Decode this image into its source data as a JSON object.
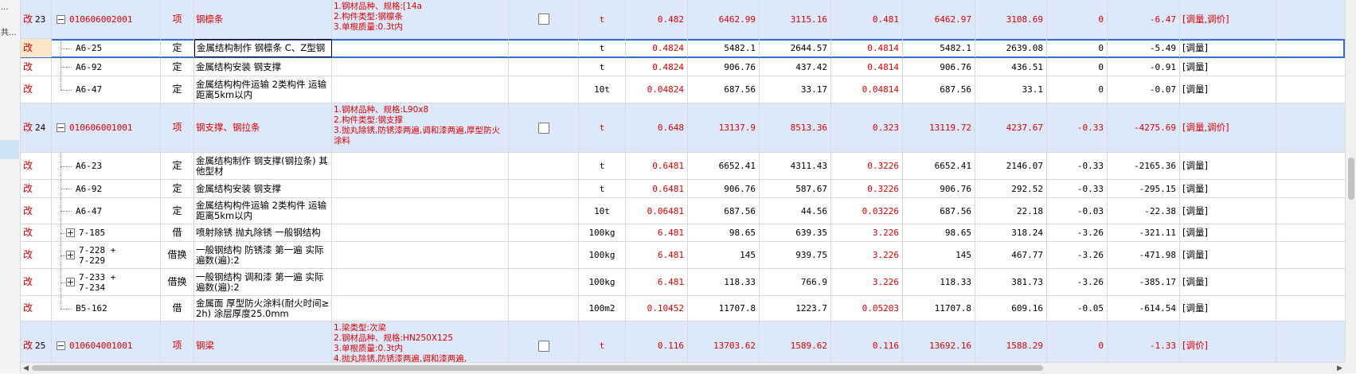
{
  "left_pane": {
    "t1": "...",
    "t2": "共..."
  },
  "rows": [
    {
      "type": "item",
      "mark": "改",
      "no": "23",
      "code": "010606002001",
      "kind": "项",
      "name": "钢檩条",
      "features": "1.钢材品种、规格:[14a\n2.构件类型:钢檩条\n3.单根质量:0.3t内",
      "unit": "t",
      "n1": "0.482",
      "n2": "6462.99",
      "n3": "3115.16",
      "n4": "0.481",
      "n5": "6462.97",
      "n6": "3108.69",
      "n7": "0",
      "n8": "-6.47",
      "adj": "[调量,调价]"
    },
    {
      "type": "sub",
      "mark": "改",
      "code": "A6-25",
      "kind": "定",
      "name": "金属结构制作 钢檩条 C、Z型钢",
      "unit": "t",
      "n1": "0.4824",
      "n2": "5482.1",
      "n3": "2644.57",
      "n4": "0.4814",
      "n5": "5482.1",
      "n6": "2639.08",
      "n7": "0",
      "n8": "-5.49",
      "adj": "[调量]"
    },
    {
      "type": "sub",
      "mark": "改",
      "code": "A6-92",
      "kind": "定",
      "name": "金属结构安装 钢支撑",
      "unit": "t",
      "n1": "0.4824",
      "n2": "906.76",
      "n3": "437.42",
      "n4": "0.4814",
      "n5": "906.76",
      "n6": "436.51",
      "n7": "0",
      "n8": "-0.91",
      "adj": "[调量]"
    },
    {
      "type": "sub",
      "mark": "改",
      "code": "A6-47",
      "kind": "定",
      "name": "金属结构构件运输 2类构件 运输距离5km以内",
      "unit": "10t",
      "n1": "0.04824",
      "n2": "687.56",
      "n3": "33.17",
      "n4": "0.04814",
      "n5": "687.56",
      "n6": "33.1",
      "n7": "0",
      "n8": "-0.07",
      "adj": "[调量]"
    },
    {
      "type": "item",
      "mark": "改",
      "no": "24",
      "code": "010606001001",
      "kind": "项",
      "name": "钢支撑、钢拉条",
      "features": "1.钢材品种、规格:L90x8\n2.构件类型:钢支撑\n3.抛丸除锈,防锈漆两遍,调和漆两遍,厚型防火涂料",
      "unit": "t",
      "n1": "0.648",
      "n2": "13137.9",
      "n3": "8513.36",
      "n4": "0.323",
      "n5": "13119.72",
      "n6": "4237.67",
      "n7": "-0.33",
      "n8": "-4275.69",
      "adj": "[调量,调价]"
    },
    {
      "type": "sub",
      "mark": "改",
      "code": "A6-23",
      "kind": "定",
      "name": "金属结构制作 钢支撑(钢拉条) 其他型材",
      "unit": "t",
      "n1": "0.6481",
      "n2": "6652.41",
      "n3": "4311.43",
      "n4": "0.3226",
      "n5": "6652.41",
      "n6": "2146.07",
      "n7": "-0.33",
      "n8": "-2165.36",
      "adj": "[调量]"
    },
    {
      "type": "sub",
      "mark": "改",
      "code": "A6-92",
      "kind": "定",
      "name": "金属结构安装 钢支撑",
      "unit": "t",
      "n1": "0.6481",
      "n2": "906.76",
      "n3": "587.67",
      "n4": "0.3226",
      "n5": "906.76",
      "n6": "292.52",
      "n7": "-0.33",
      "n8": "-295.15",
      "adj": "[调量]"
    },
    {
      "type": "sub",
      "mark": "改",
      "code": "A6-47",
      "kind": "定",
      "name": "金属结构构件运输 2类构件 运输距离5km以内",
      "unit": "10t",
      "n1": "0.06481",
      "n2": "687.56",
      "n3": "44.56",
      "n4": "0.03226",
      "n5": "687.56",
      "n6": "22.18",
      "n7": "-0.03",
      "n8": "-22.38",
      "adj": "[调量]"
    },
    {
      "type": "sub",
      "mark": "改",
      "code": "7-185",
      "kind": "借",
      "name": "喷射除锈 抛丸除锈 一般钢结构",
      "unit": "100kg",
      "n1": "6.481",
      "n2": "98.65",
      "n3": "639.35",
      "n4": "3.226",
      "n5": "98.65",
      "n6": "318.24",
      "n7": "-3.26",
      "n8": "-321.11",
      "adj": "[调量]",
      "plus": true
    },
    {
      "type": "sub",
      "mark": "改",
      "code": "7-228 +\n7-229",
      "kind": "借换",
      "name": "一般钢结构 防锈漆 第一遍 实际遍数(遍):2",
      "unit": "100kg",
      "n1": "6.481",
      "n2": "145",
      "n3": "939.75",
      "n4": "3.226",
      "n5": "145",
      "n6": "467.77",
      "n7": "-3.26",
      "n8": "-471.98",
      "adj": "[调量]",
      "plus": true
    },
    {
      "type": "sub",
      "mark": "改",
      "code": "7-233 +\n7-234",
      "kind": "借换",
      "name": "一般钢结构 调和漆 第一遍 实际遍数(遍):2",
      "unit": "100kg",
      "n1": "6.481",
      "n2": "118.33",
      "n3": "766.9",
      "n4": "3.226",
      "n5": "118.33",
      "n6": "381.73",
      "n7": "-3.26",
      "n8": "-385.17",
      "adj": "[调量]",
      "plus": true
    },
    {
      "type": "sub",
      "mark": "改",
      "code": "B5-162",
      "kind": "借",
      "name": "金属面 厚型防火涂料(耐火时间≥2h) 涂层厚度25.0mm",
      "unit": "100m2",
      "n1": "0.10452",
      "n2": "11707.8",
      "n3": "1223.7",
      "n4": "0.05203",
      "n5": "11707.8",
      "n6": "609.16",
      "n7": "-0.05",
      "n8": "-614.54",
      "adj": "[调量]",
      "last": true
    },
    {
      "type": "item",
      "mark": "改",
      "no": "25",
      "code": "010604001001",
      "kind": "项",
      "name": "钢梁",
      "features": "1.梁类型:次梁\n2.钢材品种、规格:HN250X125\n3.单根质量:0.3t内\n4.抛丸除锈,防锈漆两遍,调和漆两遍,",
      "unit": "t",
      "n1": "0.116",
      "n2": "13703.62",
      "n3": "1589.62",
      "n4": "0.116",
      "n5": "13692.16",
      "n6": "1588.29",
      "n7": "0",
      "n8": "-1.33",
      "adj": "[调价]"
    }
  ]
}
